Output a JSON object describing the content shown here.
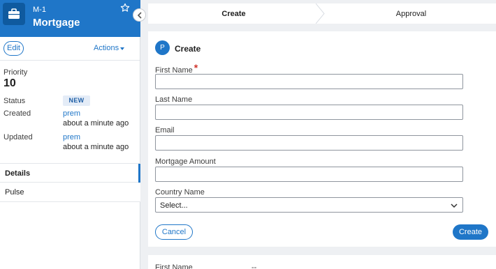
{
  "case": {
    "id": "M-1",
    "title": "Mortgage",
    "edit_label": "Edit",
    "actions_label": "Actions",
    "priority_label": "Priority",
    "priority_value": "10",
    "status_label": "Status",
    "status_value": "NEW",
    "created_label": "Created",
    "created_by": "prem",
    "created_time": "about a minute ago",
    "updated_label": "Updated",
    "updated_by": "prem",
    "updated_time": "about a minute ago"
  },
  "sidebar_tabs": [
    {
      "label": "Details",
      "active": true
    },
    {
      "label": "Pulse",
      "active": false
    }
  ],
  "stages": [
    {
      "label": "Create",
      "active": true
    },
    {
      "label": "Approval",
      "active": false
    }
  ],
  "form": {
    "avatar_letter": "P",
    "title": "Create",
    "fields": [
      {
        "label": "First Name",
        "required": true,
        "value": ""
      },
      {
        "label": "Last Name",
        "required": false,
        "value": ""
      },
      {
        "label": "Email",
        "required": false,
        "value": ""
      },
      {
        "label": "Mortgage Amount",
        "required": false,
        "value": ""
      }
    ],
    "country_label": "Country Name",
    "country_value": "Select...",
    "cancel_label": "Cancel",
    "submit_label": "Create",
    "required_mark": "*"
  },
  "summary": {
    "first_name_label": "First Name",
    "first_name_value": "--"
  },
  "colors": {
    "brand": "#1f76c8",
    "required": "#d0342c",
    "background": "#eef0f3"
  },
  "icons": {
    "case_type": "briefcase-icon",
    "favorite": "star-icon",
    "collapse": "chevron-left-icon",
    "actions_menu": "caret-down-icon",
    "select": "chevron-down-icon"
  }
}
